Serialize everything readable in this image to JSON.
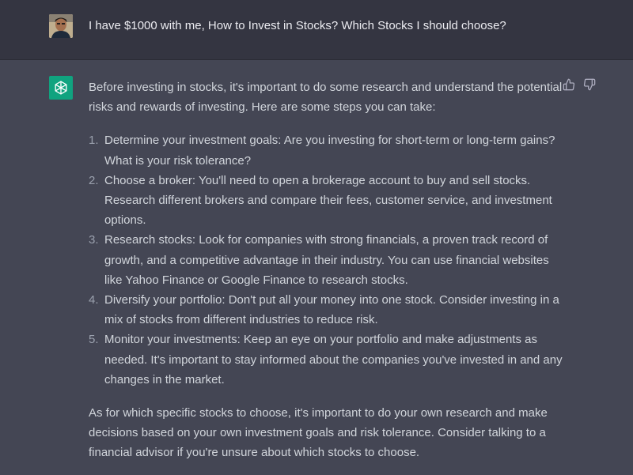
{
  "user_message": {
    "avatar_icon": "user-avatar-photo",
    "text": "I have $1000 with me, How to Invest in Stocks? Which Stocks I should choose?"
  },
  "assistant_message": {
    "logo_icon": "openai-logo-icon",
    "logo_color": "#10a37f",
    "intro": "Before investing in stocks, it's important to do some research and understand the potential risks and rewards of investing. Here are some steps you can take:",
    "steps": [
      {
        "number": "1.",
        "text": "Determine your investment goals: Are you investing for short-term or long-term gains? What is your risk tolerance?"
      },
      {
        "number": "2.",
        "text": "Choose a broker: You'll need to open a brokerage account to buy and sell stocks. Research different brokers and compare their fees, customer service, and investment options."
      },
      {
        "number": "3.",
        "text": "Research stocks: Look for companies with strong financials, a proven track record of growth, and a competitive advantage in their industry. You can use financial websites like Yahoo Finance or Google Finance to research stocks."
      },
      {
        "number": "4.",
        "text": "Diversify your portfolio: Don't put all your money into one stock. Consider investing in a mix of stocks from different industries to reduce risk."
      },
      {
        "number": "5.",
        "text": "Monitor your investments: Keep an eye on your portfolio and make adjustments as needed. It's important to stay informed about the companies you've invested in and any changes in the market."
      }
    ],
    "closing": "As for which specific stocks to choose, it's important to do your own research and make decisions based on your own investment goals and risk tolerance. Consider talking to a financial advisor if you're unsure about which stocks to choose."
  },
  "feedback": {
    "thumbs_up_icon": "thumbs-up-icon",
    "thumbs_down_icon": "thumbs-down-icon"
  },
  "colors": {
    "user_row_bg": "#343541",
    "assistant_row_bg": "#444654",
    "text": "#d1d5db"
  }
}
